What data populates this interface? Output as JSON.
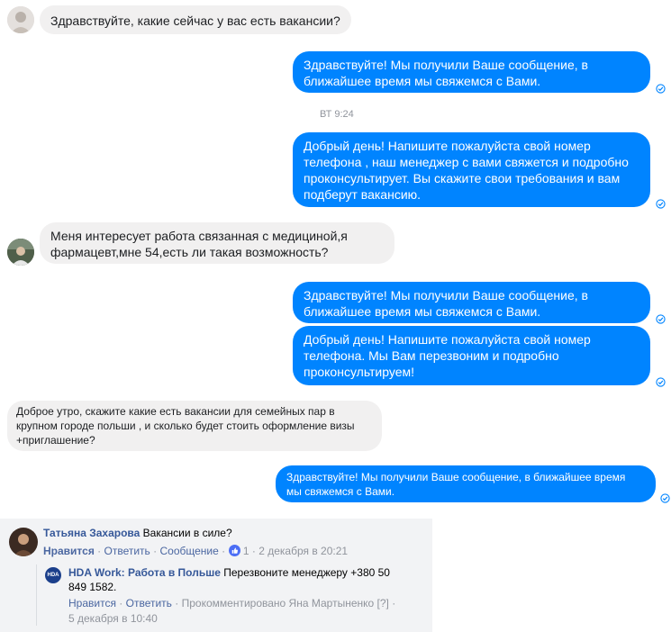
{
  "messages": [
    {
      "text": "Здравствуйте, какие сейчас у вас есть вакансии?"
    },
    {
      "text": "Здравствуйте! Мы получили Ваше сообщение, в\nближайшее время мы свяжемся с Вами."
    },
    {
      "text": "Добрый день! Напишите пожалуйста свой номер\nтелефона , наш менеджер с вами свяжется и подробно\nпроконсультирует. Вы скажите свои требования и вам\nподберут вакансию."
    },
    {
      "text": "Меня интересует работа связанная с медициной,я\nфармацевт,мне 54,есть ли такая возможность?"
    },
    {
      "text": "Здравствуйте! Мы получили Ваше сообщение, в\nближайшее время мы свяжемся с Вами."
    },
    {
      "text": "Добрый день! Напишите пожалуйста свой номер\nтелефона. Мы Вам перезвоним и подробно\nпроконсультируем!"
    },
    {
      "text": "Доброе утро, скажите какие есть вакансии для семейных пар в\nкрупном городе польши , и сколько будет стоить оформление визы\n+приглашение?"
    },
    {
      "text": "Здравствуйте! Мы получили Ваше сообщение, в ближайшее время\nмы свяжемся с Вами."
    }
  ],
  "divider_time": "ВТ 9:24",
  "comment": {
    "author": "Татьяна Захарова",
    "text": "Вакансии в силе?",
    "like": "Нравится",
    "reply": "Ответить",
    "message": "Сообщение",
    "reactions": "1",
    "date": "2 декабря в 20:21",
    "sep": "·"
  },
  "reply": {
    "author": "HDA Work: Работа в Польше",
    "text": "Перезвоните менеджеру +380 50\n849 1582.",
    "logo_text": "HDA",
    "like": "Нравится",
    "reply": "Ответить",
    "commented_by": "Прокомментировано Яна Мартыненко",
    "help": "[?]",
    "date": "5 декабря в 10:40",
    "sep": "·"
  },
  "colors": {
    "outgoing": "#0084ff",
    "incoming": "#f1f0f0",
    "link": "#365899",
    "seen": "#0084ff"
  },
  "icons": [
    "avatar-woman",
    "avatar-man",
    "seen-check-icon",
    "like-thumb-icon",
    "hda-logo"
  ]
}
